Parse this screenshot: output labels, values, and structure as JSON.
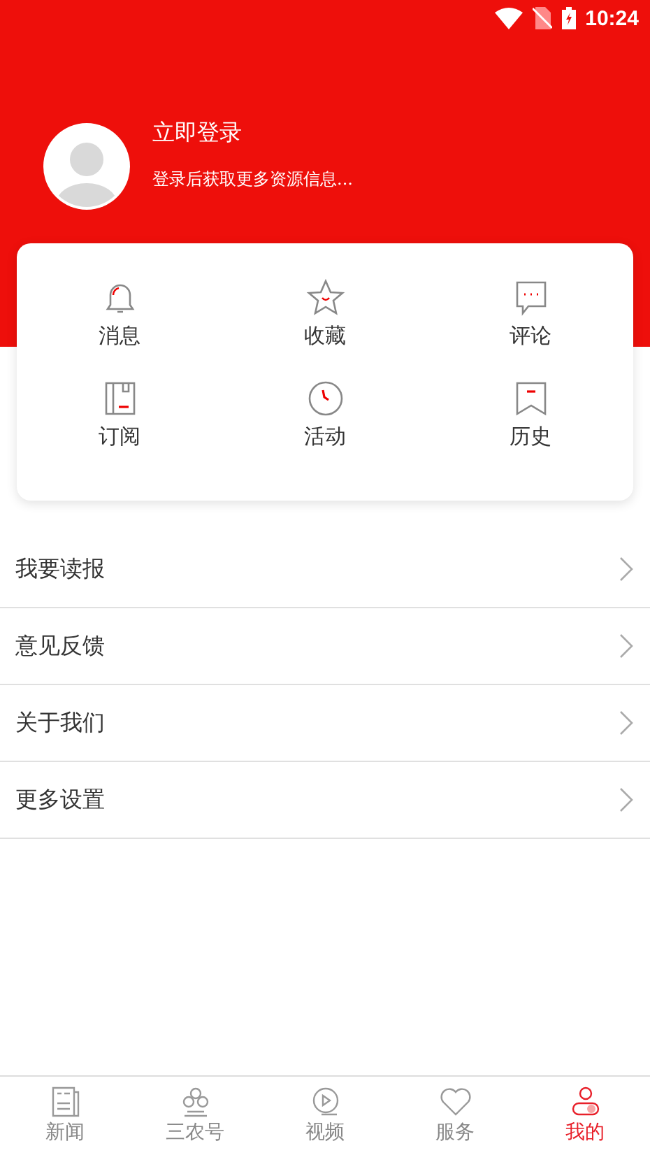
{
  "status_bar": {
    "time": "10:24"
  },
  "profile": {
    "title": "立即登录",
    "subtitle": "登录后获取更多资源信息..."
  },
  "shortcuts": [
    {
      "label": "消息",
      "kind": "bell"
    },
    {
      "label": "收藏",
      "kind": "star"
    },
    {
      "label": "评论",
      "kind": "comment"
    },
    {
      "label": "订阅",
      "kind": "book"
    },
    {
      "label": "活动",
      "kind": "clock"
    },
    {
      "label": "历史",
      "kind": "bookmark"
    }
  ],
  "menu": [
    {
      "label": "我要读报"
    },
    {
      "label": "意见反馈"
    },
    {
      "label": "关于我们"
    },
    {
      "label": "更多设置"
    }
  ],
  "tabs": [
    {
      "label": "新闻",
      "kind": "news",
      "selected": false
    },
    {
      "label": "三农号",
      "kind": "clover",
      "selected": false
    },
    {
      "label": "视频",
      "kind": "video",
      "selected": false
    },
    {
      "label": "服务",
      "kind": "heart",
      "selected": false
    },
    {
      "label": "我的",
      "kind": "user",
      "selected": true
    }
  ]
}
